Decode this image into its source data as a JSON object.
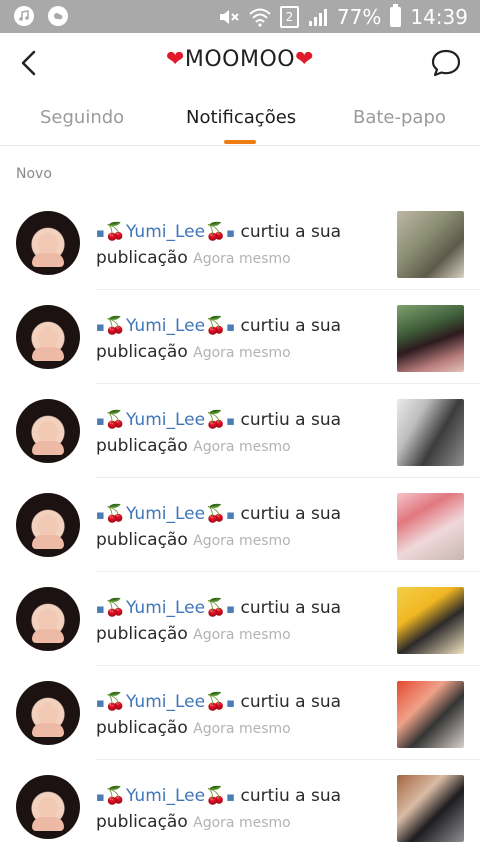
{
  "status_bar": {
    "battery": "77%",
    "time": "14:39",
    "sim_badge": "2",
    "icons": [
      "music-icon",
      "cloud-icon",
      "mute-icon",
      "wifi-icon",
      "signal-icon",
      "battery-icon"
    ]
  },
  "header": {
    "title_text": "MOOMOO",
    "heart_glyph": "❤",
    "icons": [
      "back-icon",
      "chat-bubble-icon"
    ]
  },
  "tabs": [
    {
      "label": "Seguindo",
      "active": false
    },
    {
      "label": "Notificações",
      "active": true
    },
    {
      "label": "Bate-papo",
      "active": false
    }
  ],
  "accent_color": "#f07d14",
  "section": {
    "label": "Novo"
  },
  "notifications": [
    {
      "user": "Yumi_Lee",
      "prefix_dot": "▪",
      "emoji": "🍒",
      "action": "curtiu a sua",
      "object": "publicação",
      "time": "Agora mesmo"
    },
    {
      "user": "Yumi_Lee",
      "prefix_dot": "▪",
      "emoji": "🍒",
      "action": "curtiu a sua",
      "object": "publicação",
      "time": "Agora mesmo"
    },
    {
      "user": "Yumi_Lee",
      "prefix_dot": "▪",
      "emoji": "🍒",
      "action": "curtiu a sua",
      "object": "publicação",
      "time": "Agora mesmo"
    },
    {
      "user": "Yumi_Lee",
      "prefix_dot": "▪",
      "emoji": "🍒",
      "action": "curtiu a sua",
      "object": "publicação",
      "time": "Agora mesmo"
    },
    {
      "user": "Yumi_Lee",
      "prefix_dot": "▪",
      "emoji": "🍒",
      "action": "curtiu a sua",
      "object": "publicação",
      "time": "Agora mesmo"
    },
    {
      "user": "Yumi_Lee",
      "prefix_dot": "▪",
      "emoji": "🍒",
      "action": "curtiu a sua",
      "object": "publicação",
      "time": "Agora mesmo"
    },
    {
      "user": "Yumi_Lee",
      "prefix_dot": "▪",
      "emoji": "🍒",
      "action": "curtiu a sua",
      "object": "publicação",
      "time": "Agora mesmo"
    }
  ]
}
